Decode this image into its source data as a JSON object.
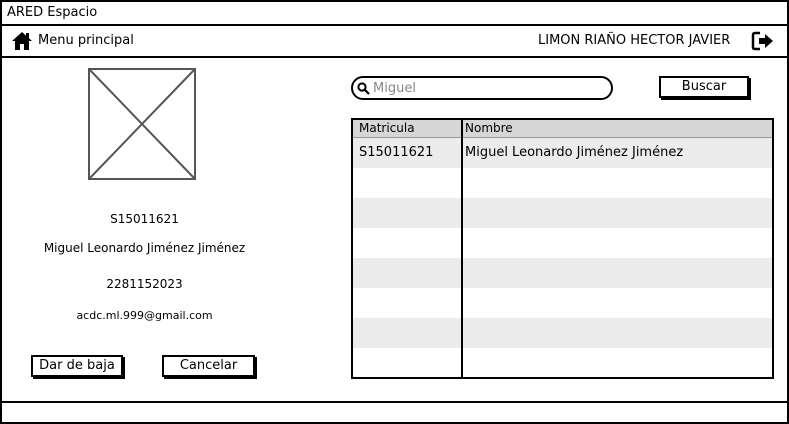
{
  "window": {
    "title": "ARED Espacio"
  },
  "menubar": {
    "home_icon": "home-icon",
    "menu_label": "Menu principal",
    "user_name": "LIMON RIAÑO HECTOR JAVIER",
    "logout_icon": "logout-icon"
  },
  "student": {
    "photo": "image-placeholder",
    "matricula": "S15011621",
    "nombre": "Miguel Leonardo Jiménez Jiménez",
    "telefono": "2281152023",
    "email": "acdc.ml.999@gmail.com"
  },
  "actions": {
    "dar_de_baja": "Dar de baja",
    "cancelar": "Cancelar"
  },
  "search": {
    "value": "Miguel",
    "button": "Buscar"
  },
  "table": {
    "columns": [
      "Matricula",
      "Nombre"
    ],
    "rows": [
      {
        "matricula": "S15011621",
        "nombre": "Miguel Leonardo Jiménez Jiménez"
      }
    ]
  }
}
